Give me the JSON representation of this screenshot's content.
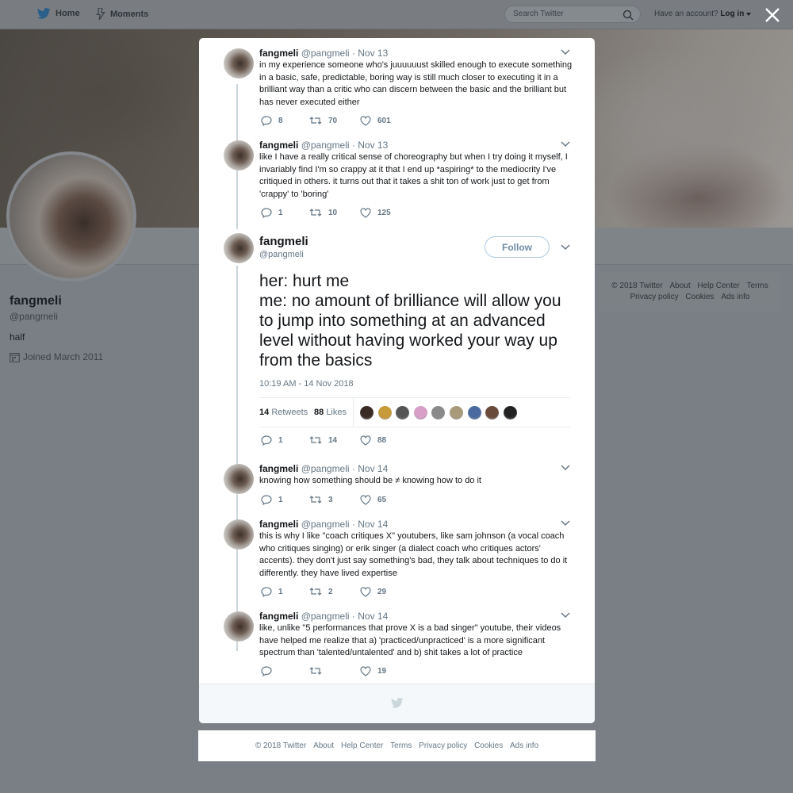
{
  "nav": {
    "home_label": "Home",
    "moments_label": "Moments",
    "search_placeholder": "Search Twitter",
    "have_account": "Have an account?",
    "login_label": "Log in"
  },
  "profile": {
    "name": "fangmeli",
    "handle": "@pangmeli",
    "bio": "half",
    "joined": "Joined March 2011"
  },
  "side_footer": {
    "copyright": "© 2018 Twitter",
    "about": "About",
    "help": "Help Center",
    "terms": "Terms",
    "privacy": "Privacy policy",
    "cookies": "Cookies",
    "ads": "Ads info"
  },
  "tweets": [
    {
      "name": "fangmeli",
      "handle": "@pangmeli",
      "date": "· Nov 13",
      "text": "in my experience someone who's juuuuuust skilled enough to execute something in a basic, safe, predictable, boring way is still much closer to executing it in a brilliant way than a critic who can discern between the basic and the brilliant but has never executed either",
      "replies": "8",
      "retweets": "70",
      "likes": "601"
    },
    {
      "name": "fangmeli",
      "handle": "@pangmeli",
      "date": "· Nov 13",
      "text": "like I have a really critical sense of choreography but when I try doing it myself, I invariably find I'm so crappy at it that I end up *aspiring* to the mediocrity I've critiqued in others. it turns out that it takes a shit ton of work just to get from 'crappy' to 'boring'",
      "replies": "1",
      "retweets": "10",
      "likes": "125"
    },
    {
      "name": "fangmeli",
      "handle": "@pangmeli",
      "date": "· Nov 14",
      "text": "knowing how something should be ≠ knowing how to do it",
      "replies": "1",
      "retweets": "3",
      "likes": "65"
    },
    {
      "name": "fangmeli",
      "handle": "@pangmeli",
      "date": "· Nov 14",
      "text": "this is why I like \"coach critiques X\" youtubers, like sam johnson (a vocal coach who critiques singing) or erik singer (a dialect coach who critiques actors' accents). they don't just say something's bad, they talk about techniques to do it differently. they have lived expertise",
      "replies": "1",
      "retweets": "2",
      "likes": "29"
    },
    {
      "name": "fangmeli",
      "handle": "@pangmeli",
      "date": "· Nov 14",
      "text": "like, unlike \"5 performances that prove X is a bad singer\" youtube, their videos have helped me realize that a) 'practiced/unpracticed' is a more significant spectrum than 'talented/untalented' and b) shit takes a lot of practice",
      "replies": "",
      "retweets": "",
      "likes": "19"
    }
  ],
  "main_tweet": {
    "name": "fangmeli",
    "handle": "@pangmeli",
    "follow_label": "Follow",
    "text_line1": "her: hurt me",
    "text_line2": "me: no amount of brilliance will allow you to jump into something at an advanced level without having worked your way up from the basics",
    "timestamp": "10:19 AM - 14 Nov 2018",
    "retweet_count": "14",
    "retweet_label": "Retweets",
    "like_count": "88",
    "like_label": "Likes",
    "replies": "1",
    "retweets": "14",
    "likes": "88",
    "liker_colors": [
      "#3a2a24",
      "#c79a3a",
      "#555555",
      "#d8a0c8",
      "#8a8a8a",
      "#a89a7a",
      "#4a6aa0",
      "#6a4a3a",
      "#222222"
    ]
  },
  "bottom_footer": {
    "copyright": "© 2018 Twitter",
    "about": "About",
    "help": "Help Center",
    "terms": "Terms",
    "privacy": "Privacy policy",
    "cookies": "Cookies",
    "ads": "Ads info"
  },
  "colors": {
    "accent": "#1da1f2",
    "muted": "#657786",
    "line": "#ccd6dd"
  }
}
